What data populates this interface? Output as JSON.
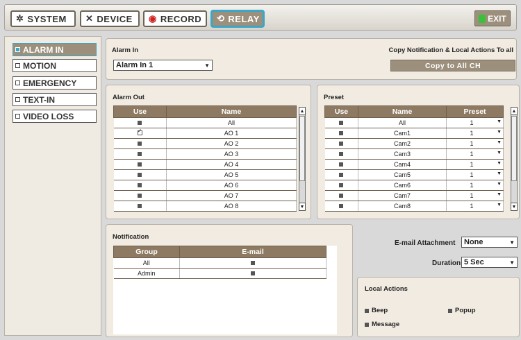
{
  "tabs": [
    {
      "label": "SYSTEM",
      "icon": "gear-icon"
    },
    {
      "label": "DEVICE",
      "icon": "tools-icon"
    },
    {
      "label": "RECORD",
      "icon": "record-icon"
    },
    {
      "label": "RELAY",
      "icon": "relay-icon"
    }
  ],
  "exit_label": "EXIT",
  "sidebar": [
    "ALARM IN",
    "MOTION",
    "EMERGENCY",
    "TEXT-IN",
    "VIDEO LOSS"
  ],
  "alarm_in": {
    "title": "Alarm In",
    "selected": "Alarm In 1",
    "copy_title": "Copy Notification & Local Actions To all",
    "copy_button": "Copy to All CH"
  },
  "alarm_out": {
    "title": "Alarm Out",
    "headers": [
      "Use",
      "Name"
    ],
    "rows": [
      {
        "use": false,
        "name": "All"
      },
      {
        "use": true,
        "name": "AO 1"
      },
      {
        "use": false,
        "name": "AO 2"
      },
      {
        "use": false,
        "name": "AO 3"
      },
      {
        "use": false,
        "name": "AO 4"
      },
      {
        "use": false,
        "name": "AO 5"
      },
      {
        "use": false,
        "name": "AO 6"
      },
      {
        "use": false,
        "name": "AO 7"
      },
      {
        "use": false,
        "name": "AO 8"
      }
    ]
  },
  "preset": {
    "title": "Preset",
    "headers": [
      "Use",
      "Name",
      "Preset"
    ],
    "rows": [
      {
        "name": "All",
        "preset": "1"
      },
      {
        "name": "Cam1",
        "preset": "1"
      },
      {
        "name": "Cam2",
        "preset": "1"
      },
      {
        "name": "Cam3",
        "preset": "1"
      },
      {
        "name": "Cam4",
        "preset": "1"
      },
      {
        "name": "Cam5",
        "preset": "1"
      },
      {
        "name": "Cam6",
        "preset": "1"
      },
      {
        "name": "Cam7",
        "preset": "1"
      },
      {
        "name": "Cam8",
        "preset": "1"
      }
    ]
  },
  "notification": {
    "title": "Notification",
    "headers": [
      "Group",
      "E-mail"
    ],
    "rows": [
      {
        "group": "All"
      },
      {
        "group": "Admin"
      }
    ]
  },
  "email_attachment": {
    "label": "E-mail Attachment",
    "value": "None"
  },
  "duration": {
    "label": "Duration",
    "value": "5 Sec"
  },
  "local_actions": {
    "title": "Local Actions",
    "beep": "Beep",
    "popup": "Popup",
    "message": "Message"
  }
}
